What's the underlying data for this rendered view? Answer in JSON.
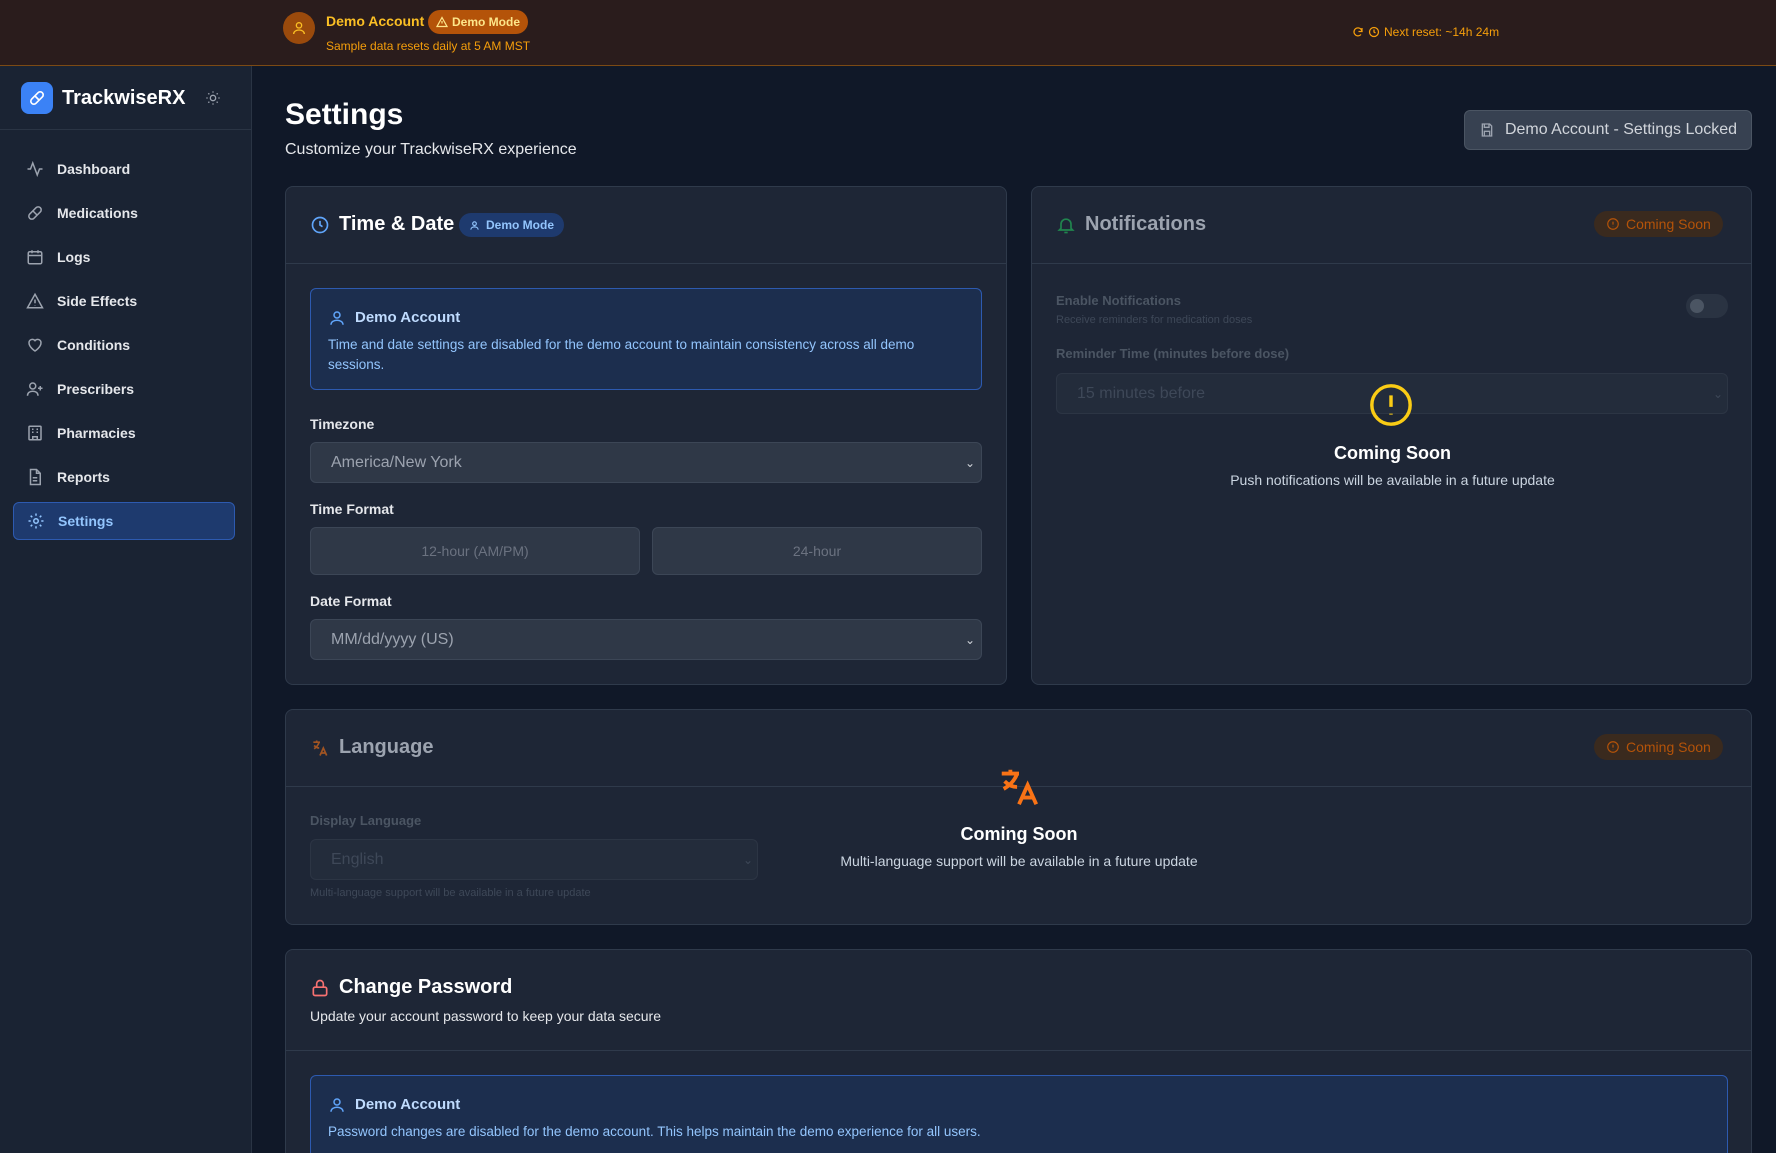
{
  "banner": {
    "account": "Demo Account",
    "badge": "Demo Mode",
    "subtitle": "Sample data resets daily at 5 AM MST",
    "reset": "Next reset: ~14h 24m"
  },
  "sidebar": {
    "brand": "TrackwiseRX",
    "items": [
      {
        "label": "Dashboard",
        "icon": "activity-icon"
      },
      {
        "label": "Medications",
        "icon": "pill-icon"
      },
      {
        "label": "Logs",
        "icon": "calendar-icon"
      },
      {
        "label": "Side Effects",
        "icon": "warning-icon"
      },
      {
        "label": "Conditions",
        "icon": "heart-icon"
      },
      {
        "label": "Prescribers",
        "icon": "user-plus-icon"
      },
      {
        "label": "Pharmacies",
        "icon": "building-icon"
      },
      {
        "label": "Reports",
        "icon": "document-icon"
      },
      {
        "label": "Settings",
        "icon": "gear-icon",
        "active": true
      }
    ]
  },
  "header": {
    "title": "Settings",
    "subtitle": "Customize your TrackwiseRX experience",
    "locked_button": "Demo Account - Settings Locked"
  },
  "time_date": {
    "title": "Time & Date",
    "badge": "Demo Mode",
    "notice_title": "Demo Account",
    "notice_text": "Time and date settings are disabled for the demo account to maintain consistency across all demo sessions.",
    "timezone_label": "Timezone",
    "timezone_value": "America/New York",
    "time_format_label": "Time Format",
    "time_format_12": "12-hour (AM/PM)",
    "time_format_24": "24-hour",
    "date_format_label": "Date Format",
    "date_format_value": "MM/dd/yyyy (US)"
  },
  "notifications": {
    "title": "Notifications",
    "badge": "Coming Soon",
    "enable_label": "Enable Notifications",
    "enable_desc": "Receive reminders for medication doses",
    "reminder_label": "Reminder Time (minutes before dose)",
    "reminder_value": "15 minutes before",
    "overlay_title": "Coming Soon",
    "overlay_text": "Push notifications will be available in a future update"
  },
  "language": {
    "title": "Language",
    "badge": "Coming Soon",
    "display_label": "Display Language",
    "display_value": "English",
    "display_help": "Multi-language support will be available in a future update",
    "overlay_title": "Coming Soon",
    "overlay_text": "Multi-language support will be available in a future update"
  },
  "password": {
    "title": "Change Password",
    "subtitle": "Update your account password to keep your data secure",
    "notice_title": "Demo Account",
    "notice_text": "Password changes are disabled for the demo account. This helps maintain the demo experience for all users."
  },
  "colors": {
    "accent": "#3b82f6",
    "amber": "#f59e0b",
    "background": "#101828",
    "card": "#1e2636"
  }
}
